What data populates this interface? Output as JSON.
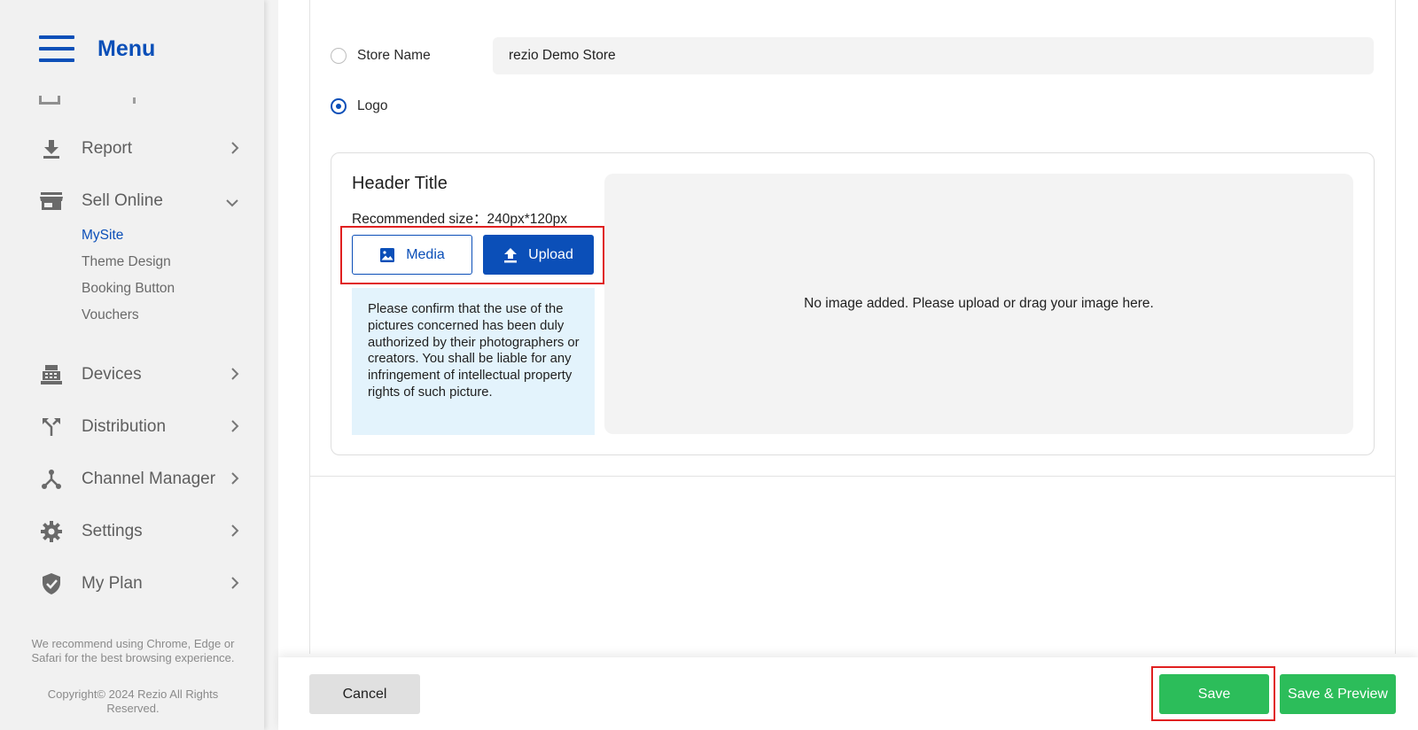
{
  "sidebar": {
    "title": "Menu",
    "items": [
      {
        "label": "Report",
        "icon": "download-icon"
      },
      {
        "label": "Sell Online",
        "icon": "store-icon"
      },
      {
        "label": "Devices",
        "icon": "cash-register-icon"
      },
      {
        "label": "Distribution",
        "icon": "split-arrows-icon"
      },
      {
        "label": "Channel Manager",
        "icon": "hub-icon"
      },
      {
        "label": "Settings",
        "icon": "gear-icon"
      },
      {
        "label": "My Plan",
        "icon": "shield-check-icon"
      }
    ],
    "sell_online_sub": [
      {
        "label": "MySite",
        "active": true
      },
      {
        "label": "Theme Design"
      },
      {
        "label": "Booking Button"
      },
      {
        "label": "Vouchers"
      }
    ],
    "footer_recommend": "We recommend using Chrome, Edge or Safari for the best browsing experience.",
    "footer_copyright": "Copyright© 2024 Rezio All Rights Reserved."
  },
  "header_options": {
    "store_name_label": "Store Name",
    "store_name_value": "rezio Demo Store",
    "logo_label": "Logo",
    "selected": "Logo"
  },
  "logo_card": {
    "title": "Header Title",
    "recommended": "Recommended size：240px*120px",
    "media_label": "Media",
    "upload_label": "Upload",
    "notice": "Please confirm that the use of the pictures concerned has been duly authorized by their photographers or creators. You shall be liable for any infringement of intellectual property rights of such picture.",
    "dropzone_text": "No image added. Please upload or drag your image here."
  },
  "footer": {
    "cancel_label": "Cancel",
    "save_label": "Save",
    "save_preview_label": "Save & Preview"
  },
  "colors": {
    "primary": "#0b4fb8",
    "success": "#2cbd5a",
    "highlight": "#e02020",
    "notice_bg": "#e3f3fc"
  }
}
